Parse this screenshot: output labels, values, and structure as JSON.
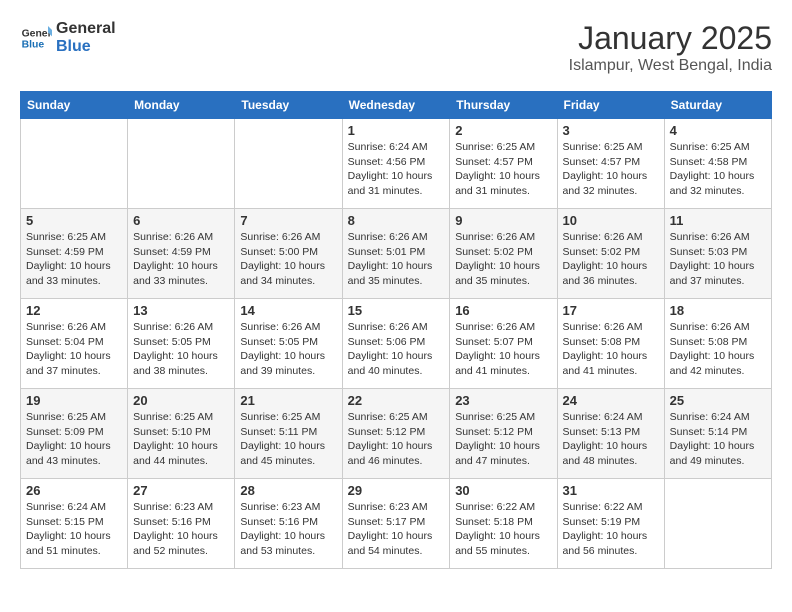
{
  "logo": {
    "line1": "General",
    "line2": "Blue"
  },
  "title": "January 2025",
  "location": "Islampur, West Bengal, India",
  "days_of_week": [
    "Sunday",
    "Monday",
    "Tuesday",
    "Wednesday",
    "Thursday",
    "Friday",
    "Saturday"
  ],
  "weeks": [
    [
      {
        "day": "",
        "info": ""
      },
      {
        "day": "",
        "info": ""
      },
      {
        "day": "",
        "info": ""
      },
      {
        "day": "1",
        "info": "Sunrise: 6:24 AM\nSunset: 4:56 PM\nDaylight: 10 hours\nand 31 minutes."
      },
      {
        "day": "2",
        "info": "Sunrise: 6:25 AM\nSunset: 4:57 PM\nDaylight: 10 hours\nand 31 minutes."
      },
      {
        "day": "3",
        "info": "Sunrise: 6:25 AM\nSunset: 4:57 PM\nDaylight: 10 hours\nand 32 minutes."
      },
      {
        "day": "4",
        "info": "Sunrise: 6:25 AM\nSunset: 4:58 PM\nDaylight: 10 hours\nand 32 minutes."
      }
    ],
    [
      {
        "day": "5",
        "info": "Sunrise: 6:25 AM\nSunset: 4:59 PM\nDaylight: 10 hours\nand 33 minutes."
      },
      {
        "day": "6",
        "info": "Sunrise: 6:26 AM\nSunset: 4:59 PM\nDaylight: 10 hours\nand 33 minutes."
      },
      {
        "day": "7",
        "info": "Sunrise: 6:26 AM\nSunset: 5:00 PM\nDaylight: 10 hours\nand 34 minutes."
      },
      {
        "day": "8",
        "info": "Sunrise: 6:26 AM\nSunset: 5:01 PM\nDaylight: 10 hours\nand 35 minutes."
      },
      {
        "day": "9",
        "info": "Sunrise: 6:26 AM\nSunset: 5:02 PM\nDaylight: 10 hours\nand 35 minutes."
      },
      {
        "day": "10",
        "info": "Sunrise: 6:26 AM\nSunset: 5:02 PM\nDaylight: 10 hours\nand 36 minutes."
      },
      {
        "day": "11",
        "info": "Sunrise: 6:26 AM\nSunset: 5:03 PM\nDaylight: 10 hours\nand 37 minutes."
      }
    ],
    [
      {
        "day": "12",
        "info": "Sunrise: 6:26 AM\nSunset: 5:04 PM\nDaylight: 10 hours\nand 37 minutes."
      },
      {
        "day": "13",
        "info": "Sunrise: 6:26 AM\nSunset: 5:05 PM\nDaylight: 10 hours\nand 38 minutes."
      },
      {
        "day": "14",
        "info": "Sunrise: 6:26 AM\nSunset: 5:05 PM\nDaylight: 10 hours\nand 39 minutes."
      },
      {
        "day": "15",
        "info": "Sunrise: 6:26 AM\nSunset: 5:06 PM\nDaylight: 10 hours\nand 40 minutes."
      },
      {
        "day": "16",
        "info": "Sunrise: 6:26 AM\nSunset: 5:07 PM\nDaylight: 10 hours\nand 41 minutes."
      },
      {
        "day": "17",
        "info": "Sunrise: 6:26 AM\nSunset: 5:08 PM\nDaylight: 10 hours\nand 41 minutes."
      },
      {
        "day": "18",
        "info": "Sunrise: 6:26 AM\nSunset: 5:08 PM\nDaylight: 10 hours\nand 42 minutes."
      }
    ],
    [
      {
        "day": "19",
        "info": "Sunrise: 6:25 AM\nSunset: 5:09 PM\nDaylight: 10 hours\nand 43 minutes."
      },
      {
        "day": "20",
        "info": "Sunrise: 6:25 AM\nSunset: 5:10 PM\nDaylight: 10 hours\nand 44 minutes."
      },
      {
        "day": "21",
        "info": "Sunrise: 6:25 AM\nSunset: 5:11 PM\nDaylight: 10 hours\nand 45 minutes."
      },
      {
        "day": "22",
        "info": "Sunrise: 6:25 AM\nSunset: 5:12 PM\nDaylight: 10 hours\nand 46 minutes."
      },
      {
        "day": "23",
        "info": "Sunrise: 6:25 AM\nSunset: 5:12 PM\nDaylight: 10 hours\nand 47 minutes."
      },
      {
        "day": "24",
        "info": "Sunrise: 6:24 AM\nSunset: 5:13 PM\nDaylight: 10 hours\nand 48 minutes."
      },
      {
        "day": "25",
        "info": "Sunrise: 6:24 AM\nSunset: 5:14 PM\nDaylight: 10 hours\nand 49 minutes."
      }
    ],
    [
      {
        "day": "26",
        "info": "Sunrise: 6:24 AM\nSunset: 5:15 PM\nDaylight: 10 hours\nand 51 minutes."
      },
      {
        "day": "27",
        "info": "Sunrise: 6:23 AM\nSunset: 5:16 PM\nDaylight: 10 hours\nand 52 minutes."
      },
      {
        "day": "28",
        "info": "Sunrise: 6:23 AM\nSunset: 5:16 PM\nDaylight: 10 hours\nand 53 minutes."
      },
      {
        "day": "29",
        "info": "Sunrise: 6:23 AM\nSunset: 5:17 PM\nDaylight: 10 hours\nand 54 minutes."
      },
      {
        "day": "30",
        "info": "Sunrise: 6:22 AM\nSunset: 5:18 PM\nDaylight: 10 hours\nand 55 minutes."
      },
      {
        "day": "31",
        "info": "Sunrise: 6:22 AM\nSunset: 5:19 PM\nDaylight: 10 hours\nand 56 minutes."
      },
      {
        "day": "",
        "info": ""
      }
    ]
  ]
}
